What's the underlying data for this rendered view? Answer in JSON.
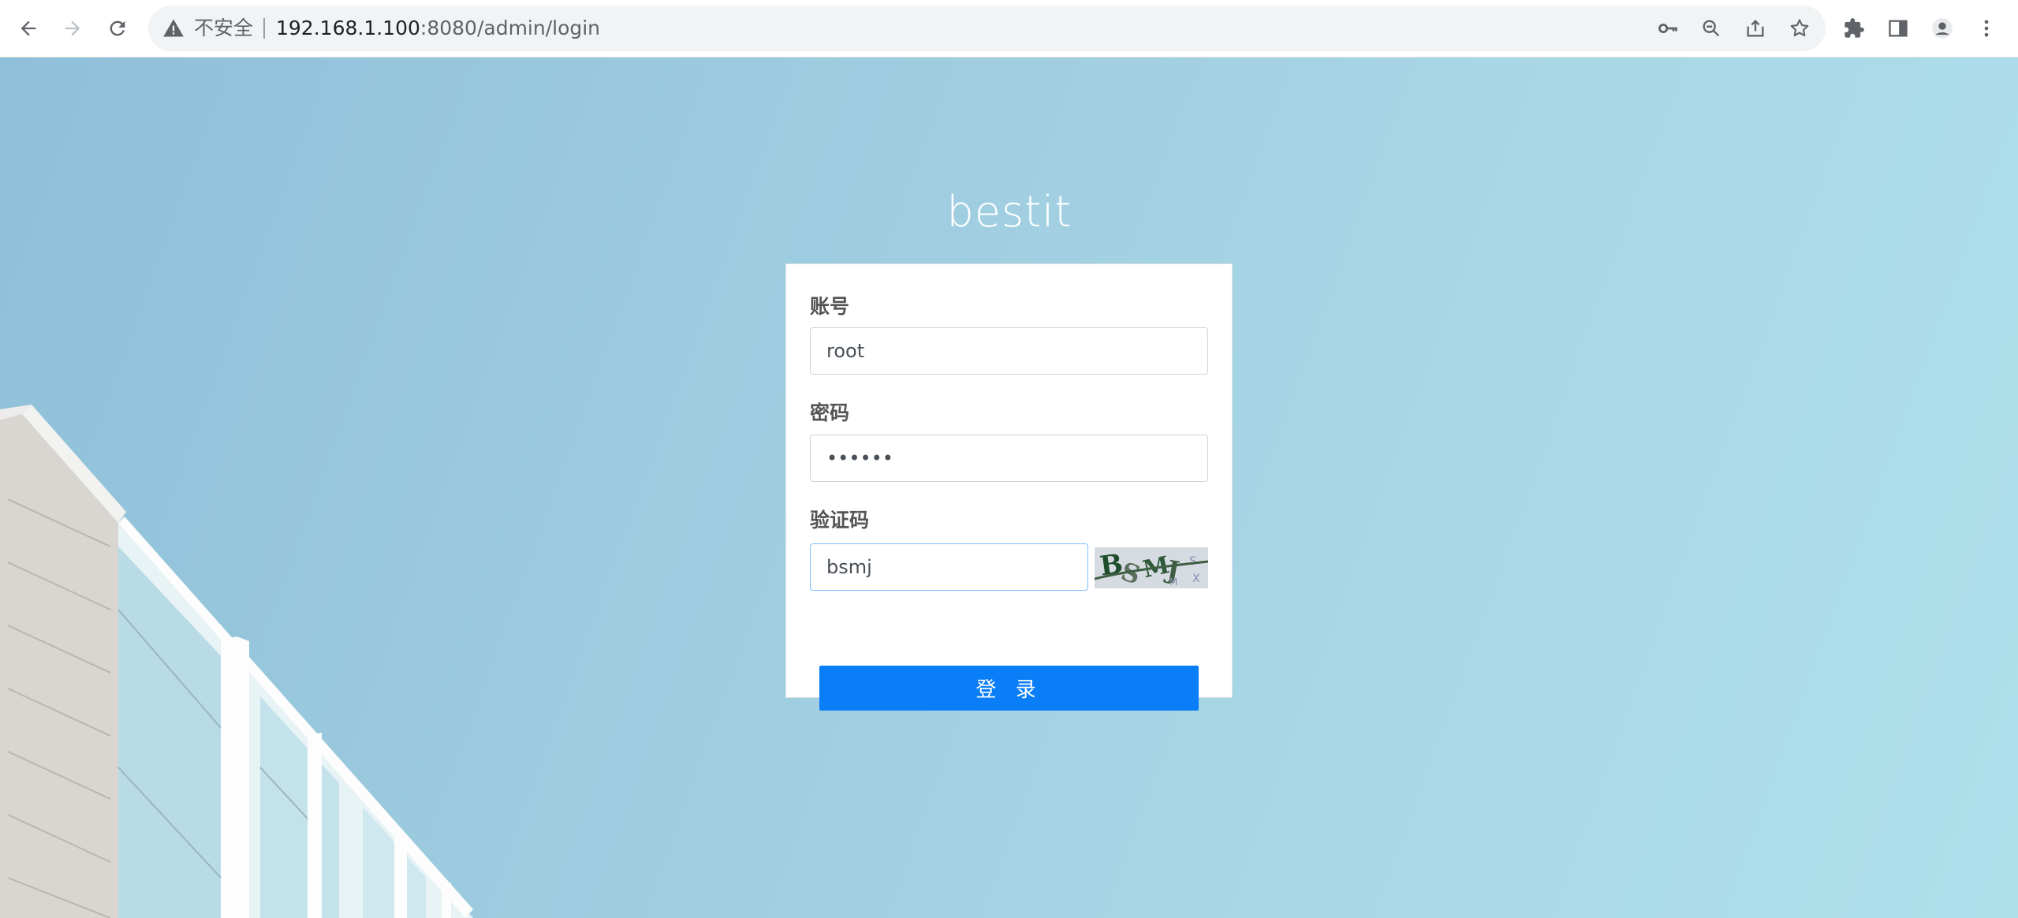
{
  "browser": {
    "security_label": "不安全",
    "url_host": "192.168.1.100",
    "url_rest": ":8080/admin/login",
    "nav_icons": [
      "back-icon",
      "forward-icon",
      "reload-icon"
    ],
    "omnibox_icons": [
      "key-icon",
      "zoom-out-icon",
      "share-icon",
      "star-icon"
    ],
    "toolbar_icons": [
      "extensions-icon",
      "side-panel-icon",
      "profile-icon",
      "menu-icon"
    ]
  },
  "page": {
    "brand": "bestit",
    "form": {
      "account_label": "账号",
      "account_value": "root",
      "password_label": "密码",
      "password_value": "••••••",
      "captcha_label": "验证码",
      "captcha_value": "bsmj",
      "captcha_image_text": "BSMJ",
      "login_button": "登 录"
    }
  },
  "colors": {
    "primary_button": "#0a7ef7",
    "background": "#a4d3e4",
    "focus_border": "#80bdff"
  }
}
